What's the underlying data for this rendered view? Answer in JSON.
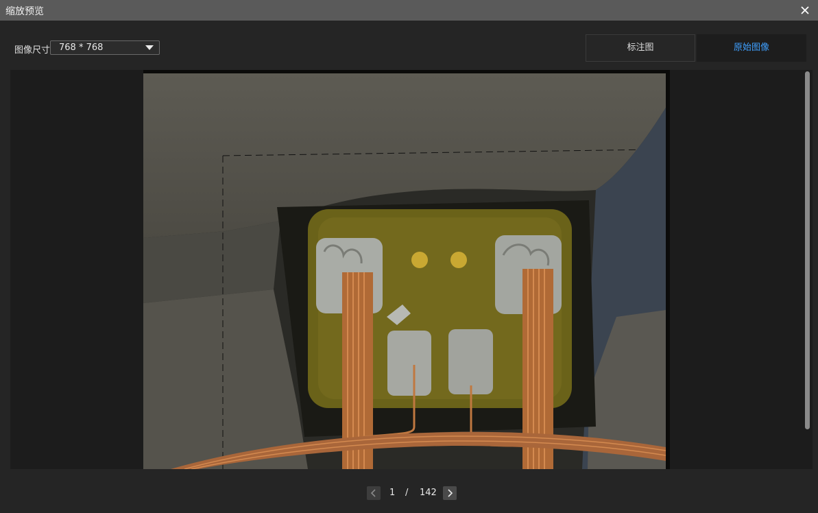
{
  "window": {
    "title": "缩放预览",
    "close_icon": "close-icon"
  },
  "toolbar": {
    "size_label": "图像尺寸",
    "size_value": "768 * 768",
    "annotated_tab": "标注图",
    "original_tab": "原始图像",
    "active_tab": "原始图像",
    "active_color": "#3fa0ff"
  },
  "preview": {
    "image_icon": "circuit-board-photo"
  },
  "pager": {
    "current": "1",
    "separator": "/",
    "total": "142",
    "prev_icon": "chevron-left-icon",
    "next_icon": "chevron-right-icon"
  }
}
